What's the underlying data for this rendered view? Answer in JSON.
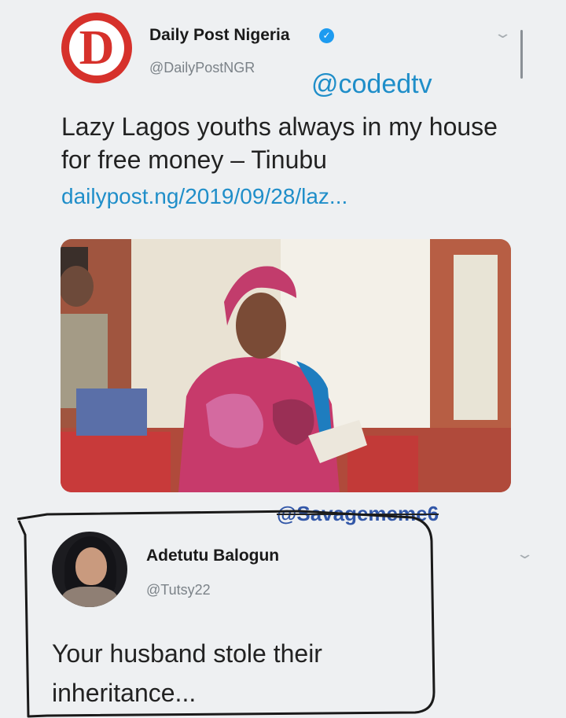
{
  "tweet": {
    "logo_letter": "D",
    "account_name": "Daily Post Nigeria",
    "verified_icon": "verified-badge-icon",
    "handle": "@DailyPostNGR",
    "watermark": "@codedtv",
    "text": "Lazy Lagos youths always in my house for free money – Tinubu",
    "link": "dailypost.ng/2019/09/28/laz...",
    "menu_icon": "chevron-down-icon"
  },
  "media_watermark": "@Savagememe6",
  "reply": {
    "account_name": "Adetutu Balogun",
    "handle": "@Tutsy22",
    "text": "Your husband stole their inheritance...",
    "menu_icon": "chevron-down-icon"
  },
  "colors": {
    "brand_red": "#d6312b",
    "link_blue": "#1f8ec9",
    "verified_blue": "#1d9bf0",
    "muted_text": "#7b8288"
  }
}
